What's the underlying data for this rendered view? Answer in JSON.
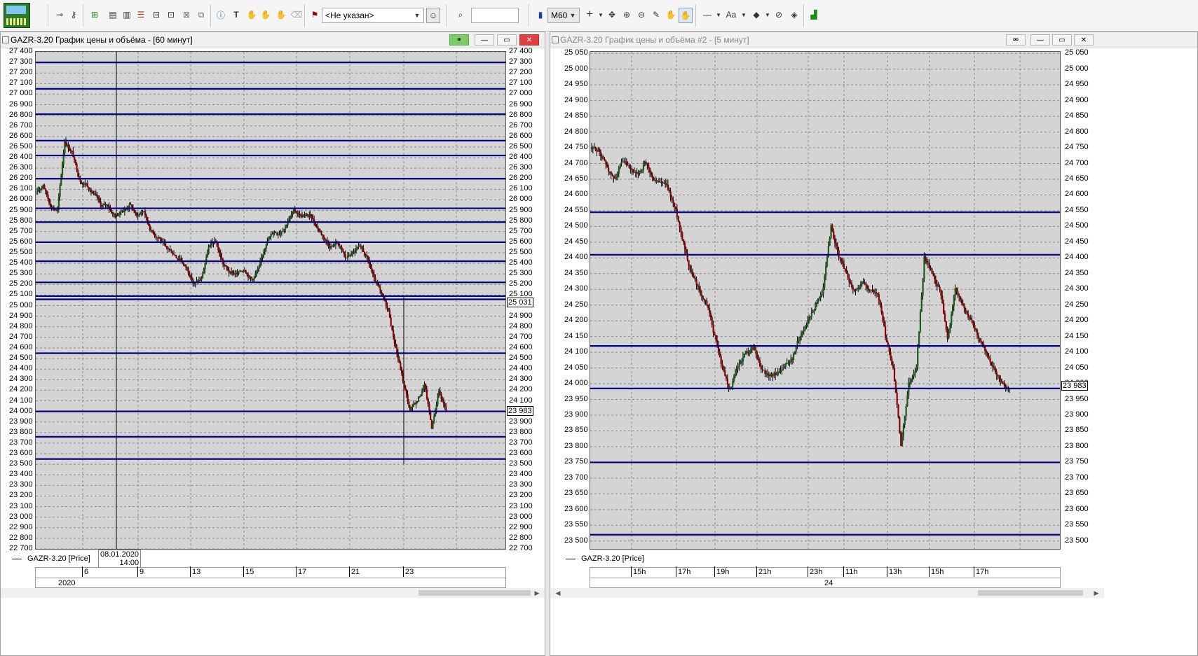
{
  "toolbar": {
    "timeframe": "M60",
    "filter_value": "<Не указан>",
    "search_value": "",
    "icons": [
      "app-logo",
      "pin-icon",
      "key-icon",
      "add-chart-icon",
      "chart-window-icon",
      "chart-window2-icon",
      "table-icon",
      "portfolio-icon",
      "search-chart-icon",
      "close-chart-icon",
      "copy-icon",
      "alert-icon",
      "text-icon",
      "hand-icon",
      "hand2-icon",
      "hand3-icon",
      "eraser-icon",
      "user-filter-icon",
      "search-icon",
      "chart-type-icon",
      "crosshair-icon",
      "move-icon",
      "zoom-in-icon",
      "zoom-out-icon",
      "ruler-icon",
      "hand-drag-icon",
      "pan-icon",
      "line-style-icon",
      "font-icon",
      "fill-icon",
      "hide-icon",
      "layers-icon",
      "indicator-icon"
    ]
  },
  "colors": {
    "grid_bg": "#d4d4d4",
    "hline": "#000080",
    "candle_up": "#1a5a1a",
    "candle_down": "#8b0000"
  },
  "window1": {
    "title": "GAZR-3.20 График цены и объёма - [60 минут]",
    "legend": "GAZR-3.20 [Price]",
    "cursor_date": "08.01.2020",
    "cursor_time": "14:00",
    "price_tag": "25 031",
    "price_tag2": "23 983",
    "year_label": "2020",
    "day_labels": [
      "6",
      "9",
      "13",
      "15",
      "17",
      "21",
      "23"
    ]
  },
  "window2": {
    "title": "GAZR-3.20 График цены и объёма #2 - [5 минут]",
    "legend": "GAZR-3.20 [Price]",
    "price_tag": "23 983",
    "day_label": "24",
    "hour_labels": [
      "15h",
      "17h",
      "19h",
      "21h",
      "23h",
      "11h",
      "13h",
      "15h",
      "17h"
    ]
  },
  "chart_data": [
    {
      "type": "candlestick",
      "title": "GAZR-3.20 График цены и объёма - [60 минут]",
      "ylim": [
        22700,
        27400
      ],
      "y_ticks": [
        "27 400",
        "27 300",
        "27 200",
        "27 100",
        "27 000",
        "26 900",
        "26 800",
        "26 700",
        "26 600",
        "26 500",
        "26 400",
        "26 300",
        "26 200",
        "26 100",
        "26 000",
        "25 900",
        "25 800",
        "25 700",
        "25 600",
        "25 500",
        "25 400",
        "25 300",
        "25 200",
        "25 100",
        "25 000",
        "24 900",
        "24 800",
        "24 700",
        "24 600",
        "24 500",
        "24 400",
        "24 300",
        "24 200",
        "24 100",
        "24 000",
        "23 900",
        "23 800",
        "23 700",
        "23 600",
        "23 500",
        "23 400",
        "23 300",
        "23 200",
        "23 100",
        "23 000",
        "22 900",
        "22 800",
        "22 700"
      ],
      "horizontal_levels": [
        27300,
        27050,
        26810,
        26560,
        26420,
        26200,
        25920,
        25790,
        25600,
        25420,
        25220,
        25090,
        25060,
        24550,
        24000,
        23760,
        23550
      ],
      "x_labels": [
        "6",
        "9",
        "13",
        "15",
        "17",
        "21",
        "23"
      ],
      "close_path": [
        26050,
        26150,
        25950,
        25900,
        26560,
        26450,
        26200,
        26150,
        26050,
        25950,
        25950,
        25850,
        25900,
        25950,
        25850,
        25900,
        25700,
        25650,
        25550,
        25500,
        25450,
        25350,
        25200,
        25250,
        25550,
        25600,
        25400,
        25300,
        25300,
        25350,
        25250,
        25350,
        25600,
        25700,
        25700,
        25800,
        25900,
        25850,
        25850,
        25750,
        25650,
        25550,
        25600,
        25450,
        25500,
        25550,
        25450,
        25250,
        25100,
        24950,
        24600,
        24300,
        24000,
        24100,
        24250,
        23850,
        24200,
        24000
      ]
    },
    {
      "type": "candlestick",
      "title": "GAZR-3.20 График цены и объёма #2 - [5 минут]",
      "ylim": [
        23475,
        25055
      ],
      "y_ticks": [
        "25 050",
        "25 000",
        "24 950",
        "24 900",
        "24 850",
        "24 800",
        "24 750",
        "24 700",
        "24 650",
        "24 600",
        "24 550",
        "24 500",
        "24 450",
        "24 400",
        "24 350",
        "24 300",
        "24 250",
        "24 200",
        "24 150",
        "24 100",
        "24 050",
        "24 000",
        "23 950",
        "23 900",
        "23 850",
        "23 800",
        "23 750",
        "23 700",
        "23 650",
        "23 600",
        "23 550",
        "23 500"
      ],
      "horizontal_levels": [
        24545,
        24410,
        24120,
        23985,
        23750,
        23520
      ],
      "x_labels": [
        "15h",
        "17h",
        "19h",
        "21h",
        "23h",
        "11h",
        "13h",
        "15h",
        "17h"
      ],
      "close_path": [
        24750,
        24740,
        24700,
        24650,
        24700,
        24680,
        24660,
        24700,
        24650,
        24640,
        24620,
        24550,
        24450,
        24350,
        24300,
        24250,
        24150,
        24050,
        23980,
        24050,
        24100,
        24120,
        24050,
        24020,
        24030,
        24050,
        24080,
        24150,
        24200,
        24250,
        24300,
        24500,
        24400,
        24350,
        24300,
        24320,
        24300,
        24280,
        24150,
        24050,
        23800,
        24000,
        24050,
        24400,
        24350,
        24300,
        24150,
        24300,
        24250,
        24200,
        24150,
        24100,
        24050,
        24000,
        23980
      ]
    }
  ]
}
